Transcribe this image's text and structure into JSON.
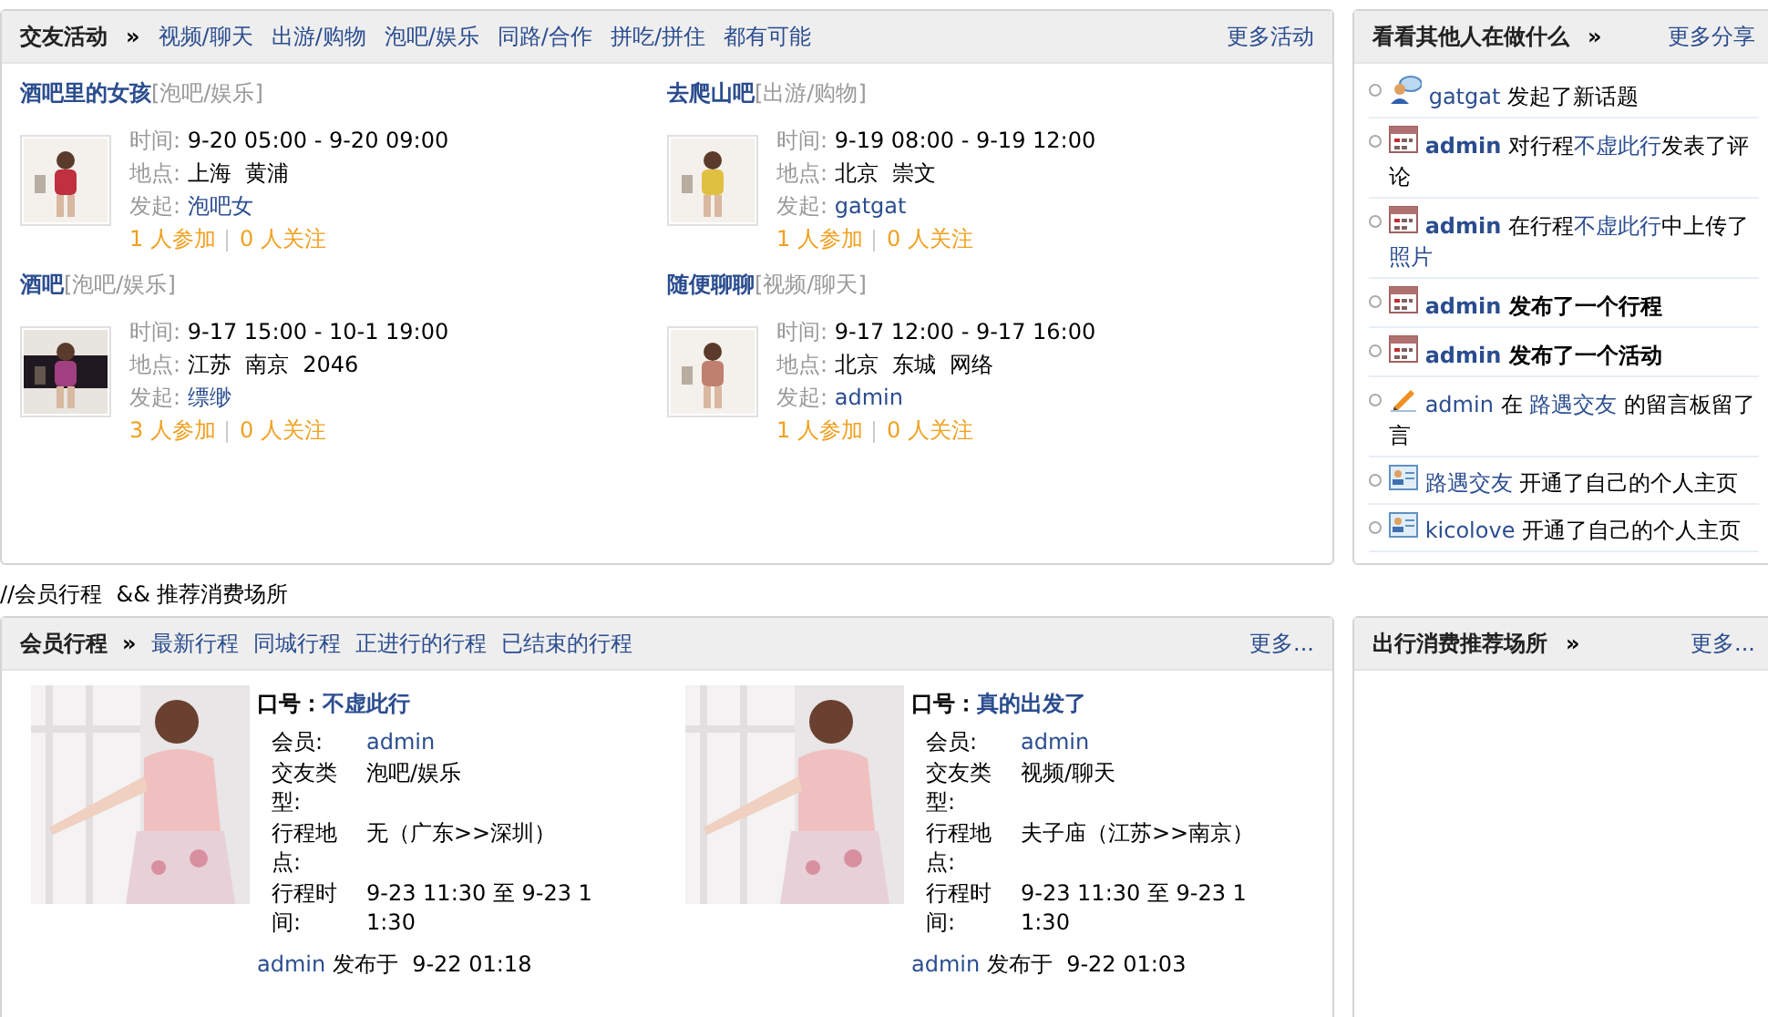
{
  "activities": {
    "title": "交友活动",
    "chevron": "»",
    "nav": [
      "视频/聊天",
      "出游/购物",
      "泡吧/娱乐",
      "同路/合作",
      "拼吃/拼住",
      "都有可能"
    ],
    "more": "更多活动",
    "items": [
      {
        "title": "酒吧里的女孩",
        "category": "[泡吧/娱乐]",
        "time_label": "时间:",
        "time": "9-20 05:00 - 9-20 09:00",
        "place_label": "地点:",
        "place": "上海  黄浦",
        "by_label": "发起:",
        "by": "泡吧女",
        "joined": "1 人参加",
        "followed": "0 人关注"
      },
      {
        "title": "去爬山吧",
        "category": "[出游/购物]",
        "time_label": "时间:",
        "time": "9-19 08:00 - 9-19 12:00",
        "place_label": "地点:",
        "place": "北京  崇文",
        "by_label": "发起:",
        "by": "gatgat",
        "joined": "1 人参加",
        "followed": "0 人关注"
      },
      {
        "title": "酒吧",
        "category": "[泡吧/娱乐]",
        "time_label": "时间:",
        "time": "9-17 15:00 - 10-1 19:00",
        "place_label": "地点:",
        "place": "江苏  南京  2046",
        "by_label": "发起:",
        "by": "缥缈",
        "joined": "3 人参加",
        "followed": "0 人关注"
      },
      {
        "title": "随便聊聊",
        "category": "[视频/聊天]",
        "time_label": "时间:",
        "time": "9-17 12:00 - 9-17 16:00",
        "place_label": "地点:",
        "place": "北京  东城  网络",
        "by_label": "发起:",
        "by": "admin",
        "joined": "1 人参加",
        "followed": "0 人关注"
      }
    ]
  },
  "feed": {
    "title": "看看其他人在做什么",
    "chevron": "»",
    "more": "更多分享",
    "items": [
      {
        "kind": "topic",
        "parts": [
          {
            "kind": "link",
            "text": "gatgat"
          },
          {
            "kind": "text",
            "text": " 发起了新话题"
          }
        ]
      },
      {
        "kind": "trip",
        "parts": [
          {
            "kind": "strong_link",
            "text": "admin"
          },
          {
            "kind": "text",
            "text": " 对行程"
          },
          {
            "kind": "link",
            "text": "不虚此行"
          },
          {
            "kind": "text",
            "text": "发表了评论"
          }
        ]
      },
      {
        "kind": "trip",
        "parts": [
          {
            "kind": "strong_link",
            "text": "admin"
          },
          {
            "kind": "text",
            "text": " 在行程"
          },
          {
            "kind": "link",
            "text": "不虚此行"
          },
          {
            "kind": "text",
            "text": "中上传了"
          },
          {
            "kind": "link",
            "text": "照片"
          }
        ]
      },
      {
        "kind": "trip",
        "parts": [
          {
            "kind": "strong_link",
            "text": "admin"
          },
          {
            "kind": "strong",
            "text": " 发布了一个行程"
          }
        ]
      },
      {
        "kind": "trip",
        "parts": [
          {
            "kind": "strong_link",
            "text": "admin"
          },
          {
            "kind": "strong",
            "text": " 发布了一个活动"
          }
        ]
      },
      {
        "kind": "message",
        "parts": [
          {
            "kind": "link",
            "text": "admin"
          },
          {
            "kind": "text",
            "text": " 在 "
          },
          {
            "kind": "link",
            "text": "路遇交友"
          },
          {
            "kind": "text",
            "text": " 的留言板留了言"
          }
        ]
      },
      {
        "kind": "profile",
        "parts": [
          {
            "kind": "link",
            "text": "路遇交友"
          },
          {
            "kind": "text",
            "text": " 开通了自己的个人主页"
          }
        ]
      },
      {
        "kind": "profile",
        "parts": [
          {
            "kind": "link",
            "text": "kicolove"
          },
          {
            "kind": "text",
            "text": " 开通了自己的个人主页"
          }
        ]
      }
    ]
  },
  "comment": "//会员行程  && 推荐消费场所",
  "trips": {
    "title": "会员行程",
    "chevron": "»",
    "nav": [
      "最新行程",
      "同城行程",
      "正进行的行程",
      "已结束的行程"
    ],
    "more": "更多...",
    "items": [
      {
        "slogan_label": "口号：",
        "slogan": "不虚此行",
        "fields": [
          {
            "label": "会员:",
            "value": "admin",
            "kind": "link"
          },
          {
            "label": "交友类型:",
            "value": "泡吧/娱乐",
            "kind": "text"
          },
          {
            "label": "行程地点:",
            "value": "无（广东>>深圳）",
            "kind": "text"
          },
          {
            "label": "行程时间:",
            "value": "9-23 11:30 至  9-23 11:30",
            "kind": "text"
          }
        ],
        "author": "admin",
        "posted": "发布于  9-22 01:18"
      },
      {
        "slogan_label": "口号：",
        "slogan": "真的出发了",
        "fields": [
          {
            "label": "会员:",
            "value": "admin",
            "kind": "link"
          },
          {
            "label": "交友类型:",
            "value": "视频/聊天",
            "kind": "text"
          },
          {
            "label": "行程地点:",
            "value": "夫子庙（江苏>>南京）",
            "kind": "text"
          },
          {
            "label": "行程时间:",
            "value": "9-23 11:30 至  9-23 11:30",
            "kind": "text"
          }
        ],
        "author": "admin",
        "posted": "发布于  9-22 01:03"
      }
    ]
  },
  "places": {
    "title": "出行消费推荐场所",
    "chevron": "»",
    "more": "更多..."
  }
}
